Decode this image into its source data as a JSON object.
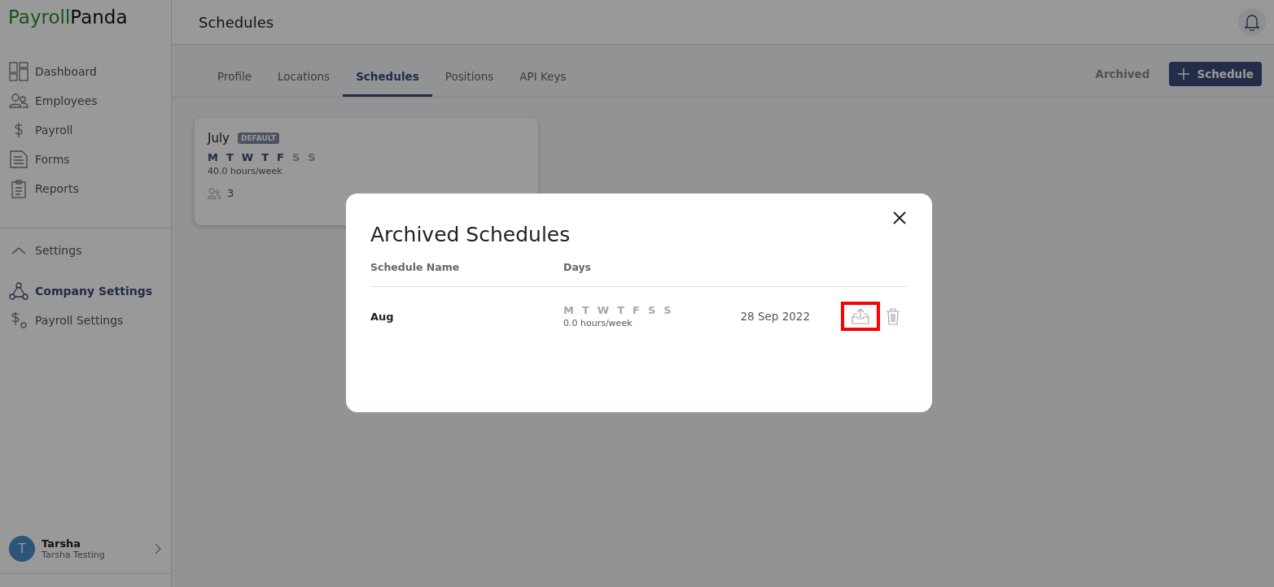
{
  "logo": {
    "first": "Payroll",
    "second": "Panda"
  },
  "sidebar": {
    "items": [
      {
        "label": "Dashboard",
        "selected": false
      },
      {
        "label": "Employees",
        "selected": false
      },
      {
        "label": "Payroll",
        "selected": false
      },
      {
        "label": "Forms",
        "selected": false
      },
      {
        "label": "Reports",
        "selected": false
      }
    ],
    "settings": {
      "label": "Settings",
      "expanded": true,
      "children": [
        {
          "label": "Company Settings",
          "selected": true
        },
        {
          "label": "Payroll Settings",
          "selected": false
        }
      ]
    },
    "user": {
      "initial": "T",
      "name": "Tarsha",
      "company": "Tarsha Testing"
    }
  },
  "header": {
    "title": "Schedules"
  },
  "tabs": [
    {
      "label": "Profile",
      "selected": false
    },
    {
      "label": "Locations",
      "selected": false
    },
    {
      "label": "Schedules",
      "selected": true
    },
    {
      "label": "Positions",
      "selected": false
    },
    {
      "label": "API Keys",
      "selected": false
    }
  ],
  "actions": {
    "archived": "Archived",
    "add": "Schedule"
  },
  "schedules": [
    {
      "name": "July",
      "badge": "DEFAULT",
      "days": [
        {
          "letter": "M",
          "on": true
        },
        {
          "letter": "T",
          "on": true
        },
        {
          "letter": "W",
          "on": true
        },
        {
          "letter": "T",
          "on": true
        },
        {
          "letter": "F",
          "on": true
        },
        {
          "letter": "S",
          "on": false
        },
        {
          "letter": "S",
          "on": false
        }
      ],
      "hours": "40.0 hours/week",
      "employees": "3"
    }
  ],
  "dialog": {
    "title": "Archived Schedules",
    "columns": [
      "Schedule Name",
      "Days"
    ],
    "rows": [
      {
        "name": "Aug",
        "days": [
          {
            "letter": "M",
            "on": false
          },
          {
            "letter": "T",
            "on": false
          },
          {
            "letter": "W",
            "on": false
          },
          {
            "letter": "T",
            "on": false
          },
          {
            "letter": "F",
            "on": false
          },
          {
            "letter": "S",
            "on": false
          },
          {
            "letter": "S",
            "on": false
          }
        ],
        "hours": "0.0 hours/week",
        "date": "28 Sep 2022",
        "highlighted": true
      }
    ]
  }
}
